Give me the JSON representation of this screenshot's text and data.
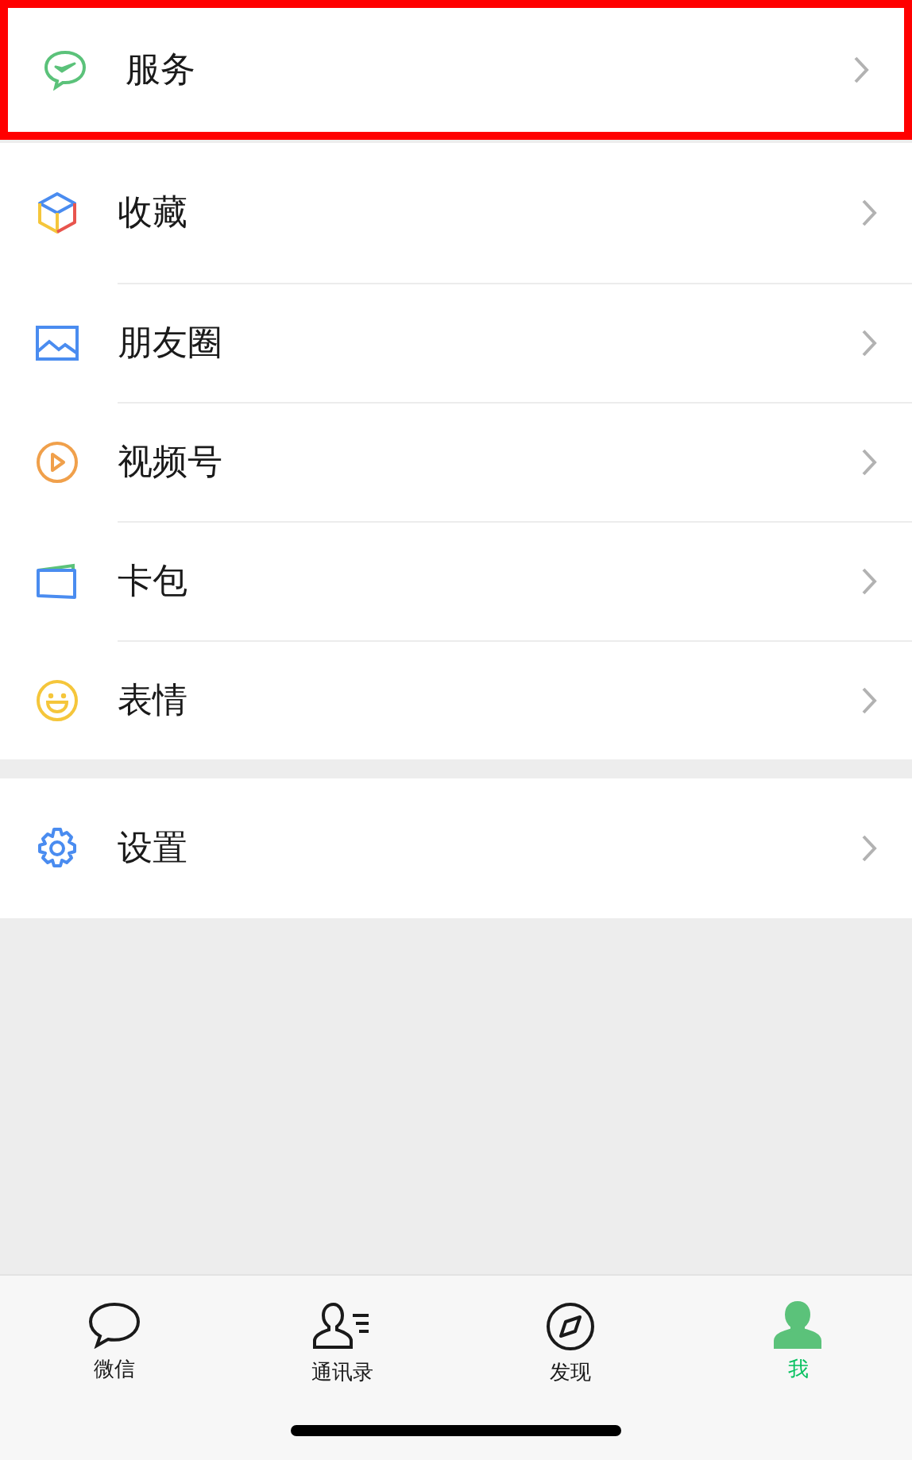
{
  "sections": [
    {
      "items": [
        {
          "label": "服务",
          "highlighted": true
        }
      ]
    },
    {
      "items": [
        {
          "label": "收藏",
          "highlighted": false
        },
        {
          "label": "朋友圈",
          "highlighted": false
        },
        {
          "label": "视频号",
          "highlighted": false
        },
        {
          "label": "卡包",
          "highlighted": false
        },
        {
          "label": "表情",
          "highlighted": false
        }
      ]
    },
    {
      "items": [
        {
          "label": "设置",
          "highlighted": false
        }
      ]
    }
  ],
  "tabs": [
    {
      "label": "微信",
      "selected": false
    },
    {
      "label": "通讯录",
      "selected": false
    },
    {
      "label": "发现",
      "selected": false
    },
    {
      "label": "我",
      "selected": true
    }
  ]
}
